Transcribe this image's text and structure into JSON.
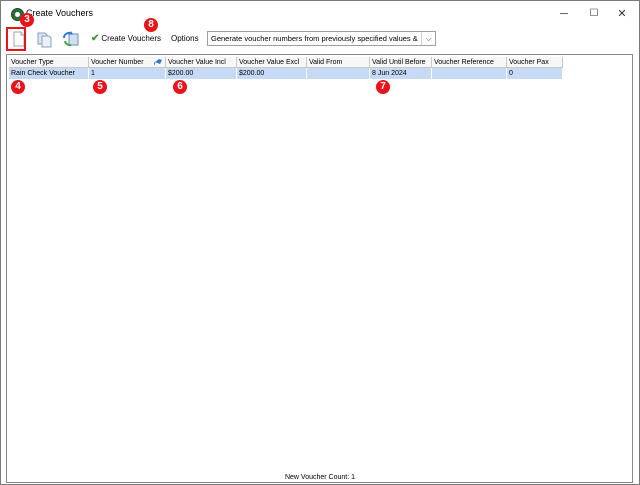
{
  "window": {
    "title": "Create Vouchers",
    "controls": {
      "minimize": "─",
      "maximize": "☐",
      "close": "✕"
    }
  },
  "toolbar": {
    "new_icon": "new-document-icon",
    "copy_icon": "copy-document-icon",
    "refresh_icon": "import-refresh-icon",
    "create_label": "Create Vouchers",
    "create_icon": "checkmark-icon",
    "options_label": "Options",
    "generate_select": {
      "value": "Generate voucher numbers from previously specified values & Use fixe"
    }
  },
  "grid": {
    "columns": [
      "Voucher Type",
      "Voucher Number",
      "Voucher Value Incl",
      "Voucher Value Excl",
      "Valid From",
      "Valid Until Before",
      "Voucher Reference",
      "Voucher Pax"
    ],
    "rows": [
      [
        "Rain Check Voucher",
        "1",
        "$200.00",
        "$200.00",
        "",
        "8 Jun 2024",
        "",
        "0"
      ]
    ]
  },
  "status": {
    "text": "New Voucher Count: 1"
  },
  "markers": [
    "3",
    "4",
    "5",
    "6",
    "7",
    "8"
  ],
  "colors": {
    "marker": "#e8141a",
    "selected_row": "#c6daf5",
    "check": "#3c9a36"
  }
}
